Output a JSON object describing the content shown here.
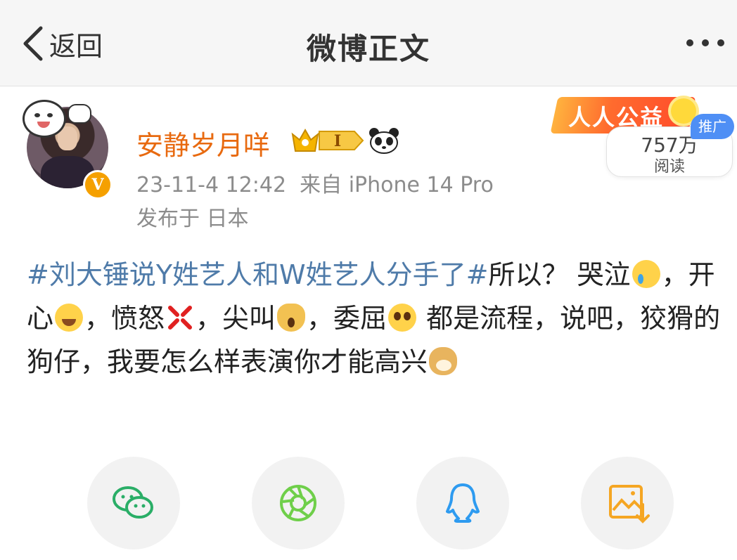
{
  "nav": {
    "back_label": "返回",
    "title": "微博正文"
  },
  "post": {
    "username": "安静岁月咩",
    "vip_level": "I",
    "timestamp": "23-11-4 12:42",
    "source": "来自 iPhone 14 Pro",
    "location": "发布于 日本",
    "verified_mark": "V",
    "promo_text": "人人公益",
    "read_count": "757万",
    "read_label": "阅读",
    "ad_badge": "推广",
    "hashtag": "#刘大锤说Y姓艺人和W姓艺人分手了#",
    "text_1": "所以？ 哭泣",
    "text_2": "，开心",
    "text_3": "，愤怒",
    "text_4": "，尖叫",
    "text_5": "，委屈",
    "text_6": " 都是流程，说吧，狡猾的狗仔，我要怎么样表演你才能高兴"
  },
  "share": {
    "icons": [
      "wechat-icon",
      "moments-icon",
      "qq-icon",
      "save-image-icon"
    ],
    "colors": {
      "wechat": "#2aae67",
      "moments": "#6fcf4a",
      "qq": "#2e9bf0",
      "save": "#f5a623"
    }
  },
  "colors": {
    "username": "#e86a10",
    "hashtag": "#4f7ba9",
    "meta": "#8c8c8c",
    "ad_badge": "#4f8ff5"
  }
}
